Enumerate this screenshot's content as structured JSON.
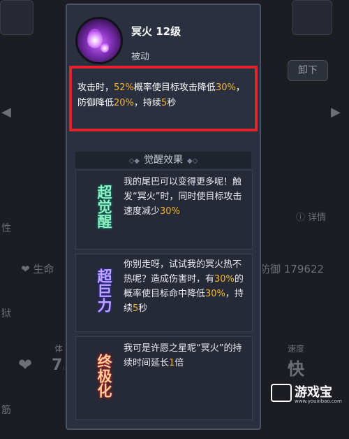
{
  "skill": {
    "name": "冥火 12级",
    "type": "被动",
    "description": [
      {
        "text": "攻击时，",
        "highlight": false
      },
      {
        "text": "52%",
        "highlight": true
      },
      {
        "text": "概率使目标攻击降低",
        "highlight": false
      },
      {
        "text": "30%",
        "highlight": true
      },
      {
        "text": "，防御降低",
        "highlight": false
      },
      {
        "text": "20%",
        "highlight": true
      },
      {
        "text": "，持续",
        "highlight": false
      },
      {
        "text": "5",
        "highlight": true
      },
      {
        "text": "秒",
        "highlight": false
      }
    ]
  },
  "awakening": {
    "header": "觉醒效果",
    "levels": [
      {
        "badge": "超觉醒",
        "segments": [
          {
            "text": "我的尾巴可以变得更多呢！触发“冥火”时，同时使目标攻击速度减少",
            "highlight": false
          },
          {
            "text": "30%",
            "highlight": true
          }
        ]
      },
      {
        "badge": "超巨力",
        "segments": [
          {
            "text": "你别走呀，试试我的冥火热不热呢？造成伤害时，有",
            "highlight": false
          },
          {
            "text": "30%",
            "highlight": true
          },
          {
            "text": "的概率使目标命中降低",
            "highlight": false
          },
          {
            "text": "30%",
            "highlight": true
          },
          {
            "text": "，持续",
            "highlight": false
          },
          {
            "text": "5",
            "highlight": true
          },
          {
            "text": "秒",
            "highlight": false
          }
        ]
      },
      {
        "badge": "终极化",
        "segments": [
          {
            "text": "我可是许愿之星呢“冥火”的持续时间延长",
            "highlight": false
          },
          {
            "text": "1",
            "highlight": true
          },
          {
            "text": "倍",
            "highlight": false
          }
        ]
      }
    ]
  },
  "background": {
    "unequip_button": "卸下",
    "details_link": "详情",
    "stat_life": "生命",
    "stat_defense": "防御 179622",
    "stat_body_label": "体",
    "stat_body_value": "7.",
    "speed_label": "速度",
    "speed_value": "快",
    "side_label_1": "性",
    "side_label_2": "狱",
    "side_label_3": "筋"
  },
  "watermark": {
    "name": "游戏宝",
    "url": "www.youxibao.com"
  },
  "colors": {
    "highlight": "#f2b92e",
    "frame_border": "#e0262b",
    "panel_bg": "#2b3040"
  }
}
